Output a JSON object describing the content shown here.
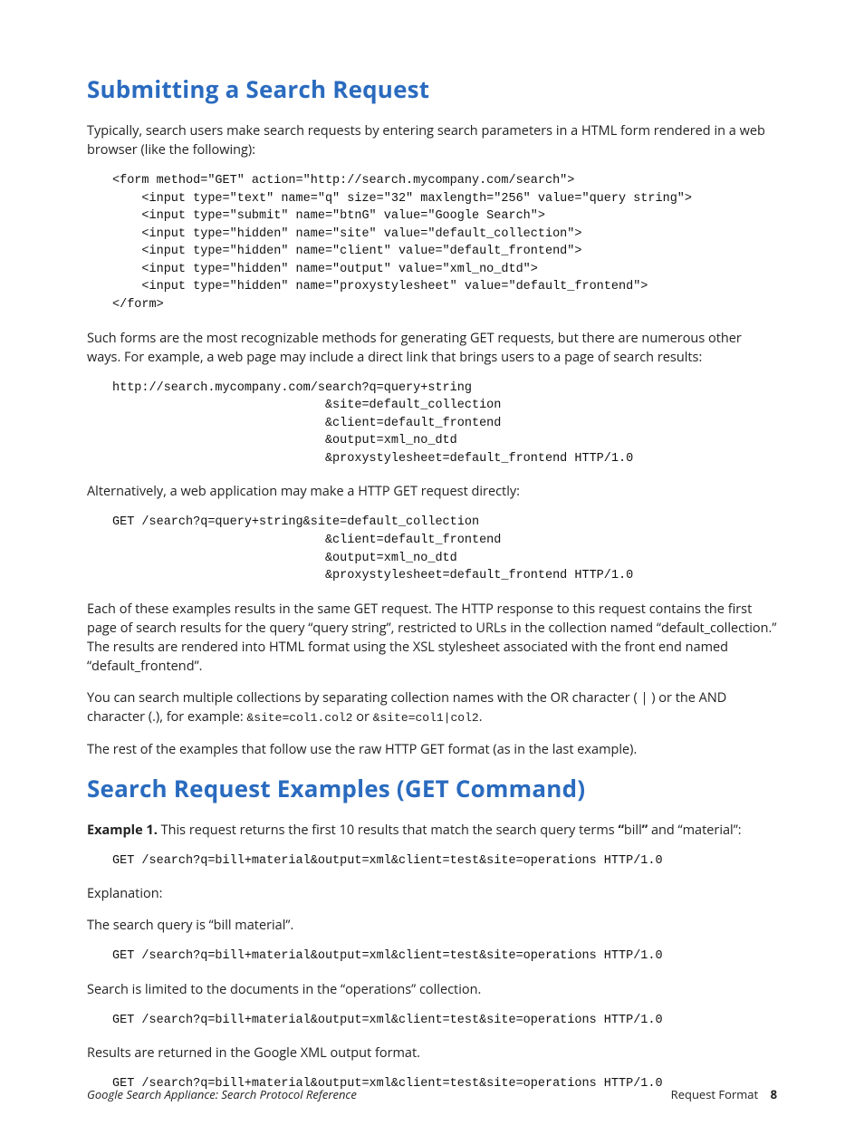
{
  "section1": {
    "heading": "Submitting a Search Request",
    "para1": "Typically, search users make search requests by entering search parameters in a HTML form rendered in a web browser (like the following):",
    "code1": "<form method=\"GET\" action=\"http://search.mycompany.com/search\">\n    <input type=\"text\" name=\"q\" size=\"32\" maxlength=\"256\" value=\"query string\">\n    <input type=\"submit\" name=\"btnG\" value=\"Google Search\">\n    <input type=\"hidden\" name=\"site\" value=\"default_collection\">\n    <input type=\"hidden\" name=\"client\" value=\"default_frontend\">\n    <input type=\"hidden\" name=\"output\" value=\"xml_no_dtd\">\n    <input type=\"hidden\" name=\"proxystylesheet\" value=\"default_frontend\">\n</form>",
    "para2": "Such forms are the most recognizable methods for generating GET requests, but there are numerous other ways. For example, a web page may include a direct link that brings users to a page of search results:",
    "code2": "http://search.mycompany.com/search?q=query+string\n                             &site=default_collection\n                             &client=default_frontend\n                             &output=xml_no_dtd\n                             &proxystylesheet=default_frontend HTTP/1.0",
    "para3": "Alternatively, a web application may make a HTTP GET request directly:",
    "code3": "GET /search?q=query+string&site=default_collection\n                             &client=default_frontend\n                             &output=xml_no_dtd\n                             &proxystylesheet=default_frontend HTTP/1.0",
    "para4": "Each of these examples results in the same GET request. The HTTP response to this request contains the first page of search results for the query “query string”, restricted to URLs in the collection named “default_collection.” The results are rendered into HTML format using the XSL stylesheet associated with the front end named “default_frontend”.",
    "para5_pre": "You can search multiple collections by separating collection names with the OR character ( | ) or the AND character (.), for example: ",
    "para5_code1": "&site=col1.col2",
    "para5_mid": " or ",
    "para5_code2": "&site=col1|col2",
    "para5_post": ".",
    "para6": "The rest of the examples that follow use the raw HTTP GET format (as in the last example)."
  },
  "section2": {
    "heading": "Search Request Examples (GET Command)",
    "ex_label": "Example 1.",
    "ex_text_pre": " This request returns the first 10 results that match the search query terms ",
    "ex_q1": "“",
    "ex_term1": "bill",
    "ex_q2": "”",
    "ex_and": " and “material”:",
    "code_ex": "GET /search?q=bill+material&output=xml&client=test&site=operations HTTP/1.0",
    "explanation_label": "Explanation:",
    "line1": "The search query is “bill material”.",
    "line2": "Search is limited to the documents in the “operations” collection.",
    "line3": "Results are returned in the Google XML output format."
  },
  "footer": {
    "left": "Google Search Appliance: Search Protocol Reference",
    "right_label": "Request Format",
    "page_num": "8"
  }
}
